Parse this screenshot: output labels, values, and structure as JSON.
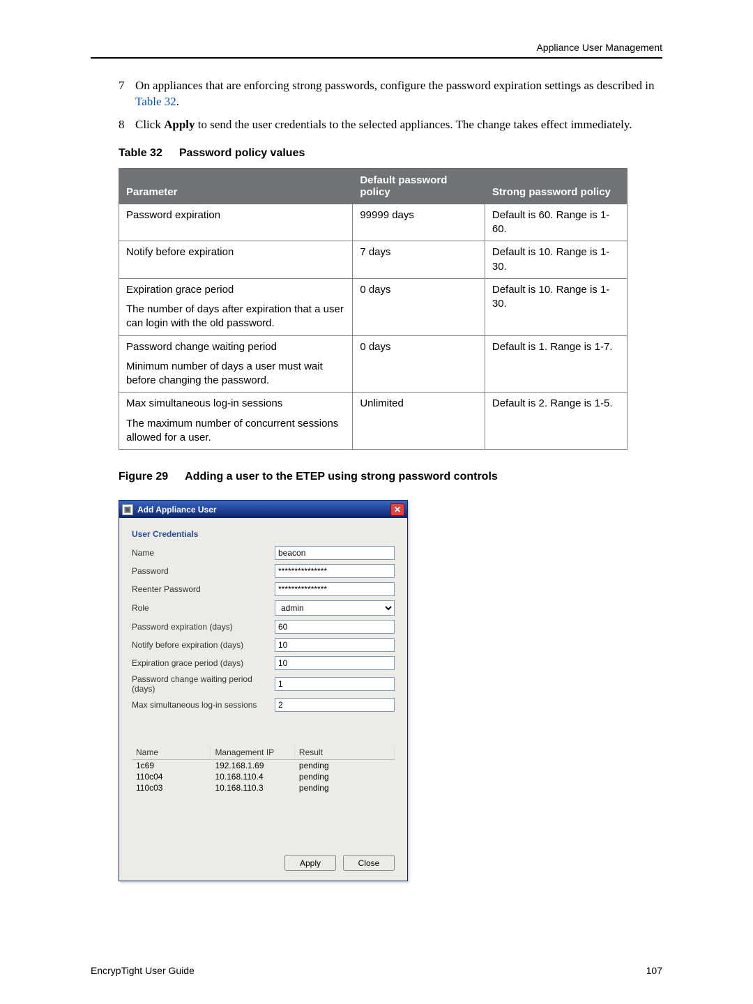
{
  "header": {
    "right_text": "Appliance User Management"
  },
  "steps": {
    "s7_num": "7",
    "s7_text_a": "On appliances that are enforcing strong passwords, configure the password expiration settings as described in ",
    "s7_link": "Table 32",
    "s7_text_b": ".",
    "s8_num": "8",
    "s8_text_a": "Click ",
    "s8_bold": "Apply",
    "s8_text_b": " to send the user credentials to the selected appliances. The change takes effect immediately."
  },
  "table32": {
    "caption_prefix": "Table 32",
    "caption_title": "Password policy values",
    "col_param": "Parameter",
    "col_default": "Default password policy",
    "col_strong": "Strong password policy",
    "rows": [
      {
        "param": "Password expiration",
        "sub": "",
        "def": "99999 days",
        "strong": "Default is 60. Range is 1-60."
      },
      {
        "param": "Notify before expiration",
        "sub": "",
        "def": "7 days",
        "strong": "Default is 10. Range is 1-30."
      },
      {
        "param": "Expiration grace period",
        "sub": "The number of days after expiration that a user can login with the old password.",
        "def": "0 days",
        "strong": "Default is 10. Range is 1-30."
      },
      {
        "param": "Password change waiting period",
        "sub": "Minimum number of days a user must wait before changing the password.",
        "def": "0 days",
        "strong": "Default is 1. Range is 1-7."
      },
      {
        "param": "Max simultaneous log-in sessions",
        "sub": "The maximum number of concurrent sessions allowed for a user.",
        "def": "Unlimited",
        "strong": "Default is 2. Range is 1-5."
      }
    ]
  },
  "figure29": {
    "caption_prefix": "Figure 29",
    "caption_title": "Adding a user to the ETEP using strong password controls"
  },
  "dialog": {
    "title": "Add Appliance User",
    "user_credentials_label": "User Credentials",
    "labels": {
      "name": "Name",
      "password": "Password",
      "reenter": "Reenter Password",
      "role": "Role",
      "pwd_exp": "Password expiration (days)",
      "notify": "Notify before expiration (days)",
      "grace": "Expiration grace period (days)",
      "wait": "Password change waiting period (days)",
      "max_sess": "Max simultaneous log-in sessions"
    },
    "values": {
      "name": "beacon",
      "password": "***************",
      "reenter": "***************",
      "role": "admin",
      "pwd_exp": "60",
      "notify": "10",
      "grace": "10",
      "wait": "1",
      "max_sess": "2"
    },
    "list": {
      "cols": {
        "name": "Name",
        "ip": "Management IP",
        "result": "Result"
      },
      "rows": [
        {
          "name": "1c69",
          "ip": "192.168.1.69",
          "result": "pending"
        },
        {
          "name": "110c04",
          "ip": "10.168.110.4",
          "result": "pending"
        },
        {
          "name": "110c03",
          "ip": "10.168.110.3",
          "result": "pending"
        }
      ]
    },
    "buttons": {
      "apply": "Apply",
      "close": "Close"
    }
  },
  "footer": {
    "left": "EncrypTight User Guide",
    "right": "107"
  }
}
